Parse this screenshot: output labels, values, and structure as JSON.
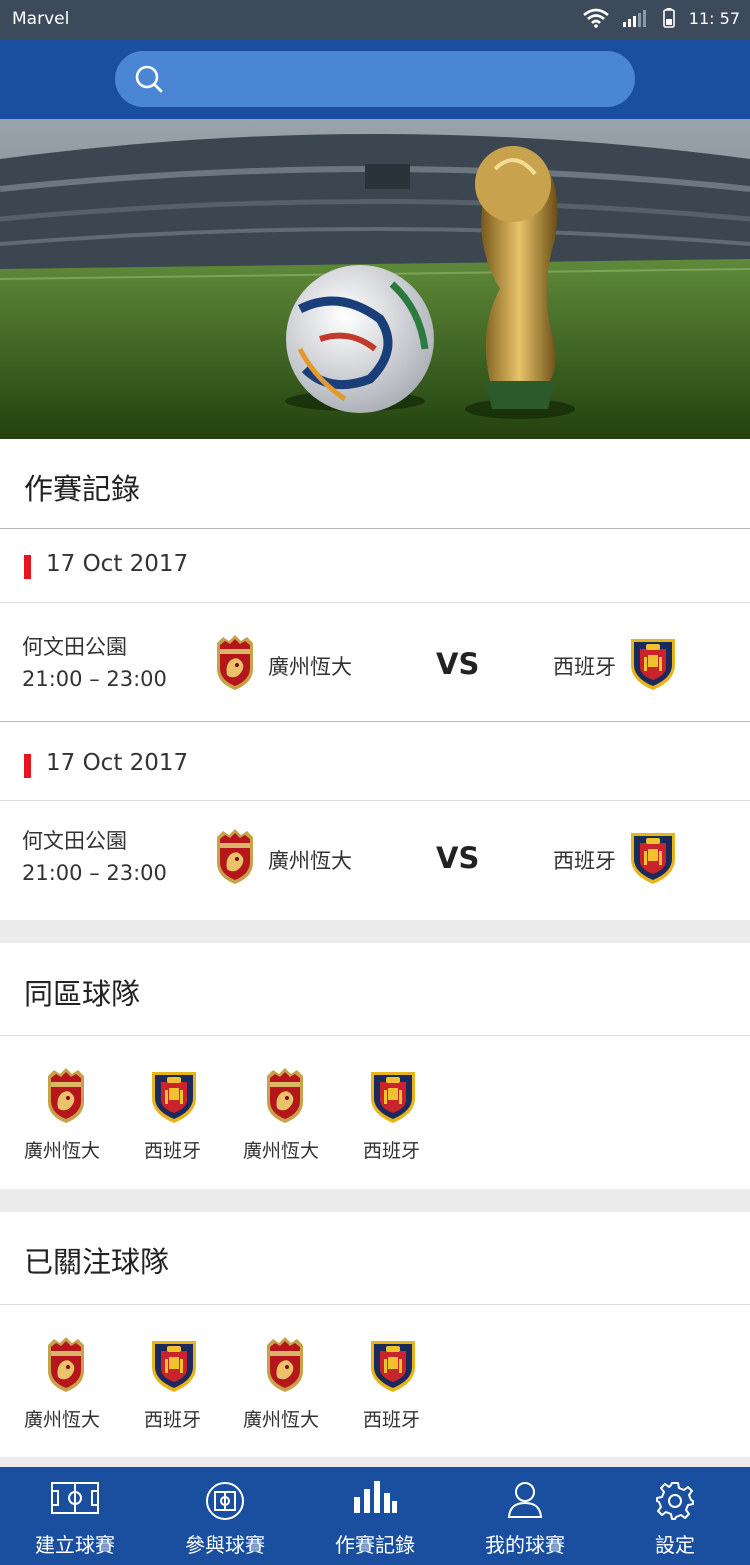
{
  "status_bar": {
    "carrier": "Marvel",
    "time": "11: 57"
  },
  "search": {
    "placeholder": ""
  },
  "records": {
    "title": "作賽記錄",
    "groups": [
      {
        "date": "17 Oct 2017",
        "venue": "何文田公園",
        "time": "21:00 – 23:00",
        "home": "廣州恆大",
        "vs": "VS",
        "away": "西班牙"
      },
      {
        "date": "17 Oct 2017",
        "venue": "何文田公園",
        "time": "21:00 – 23:00",
        "home": "廣州恆大",
        "vs": "VS",
        "away": "西班牙"
      }
    ]
  },
  "nearby": {
    "title": "同區球隊",
    "teams": [
      "廣州恆大",
      "西班牙",
      "廣州恆大",
      "西班牙"
    ]
  },
  "followed": {
    "title": "已關注球隊",
    "teams": [
      "廣州恆大",
      "西班牙",
      "廣州恆大",
      "西班牙"
    ]
  },
  "tabbar": {
    "tabs": [
      {
        "label": "建立球賽",
        "icon": "pitch-icon"
      },
      {
        "label": "參與球賽",
        "icon": "ball-icon"
      },
      {
        "label": "作賽記錄",
        "icon": "bar-chart-icon"
      },
      {
        "label": "我的球賽",
        "icon": "user-icon"
      },
      {
        "label": "設定",
        "icon": "gear-icon"
      }
    ]
  },
  "colors": {
    "header": "#1a4fa0",
    "search_fill": "#4a86d4",
    "status_bar": "#3d4a5c",
    "date_marker": "#e8141b",
    "section_gap": "#ebebeb"
  }
}
